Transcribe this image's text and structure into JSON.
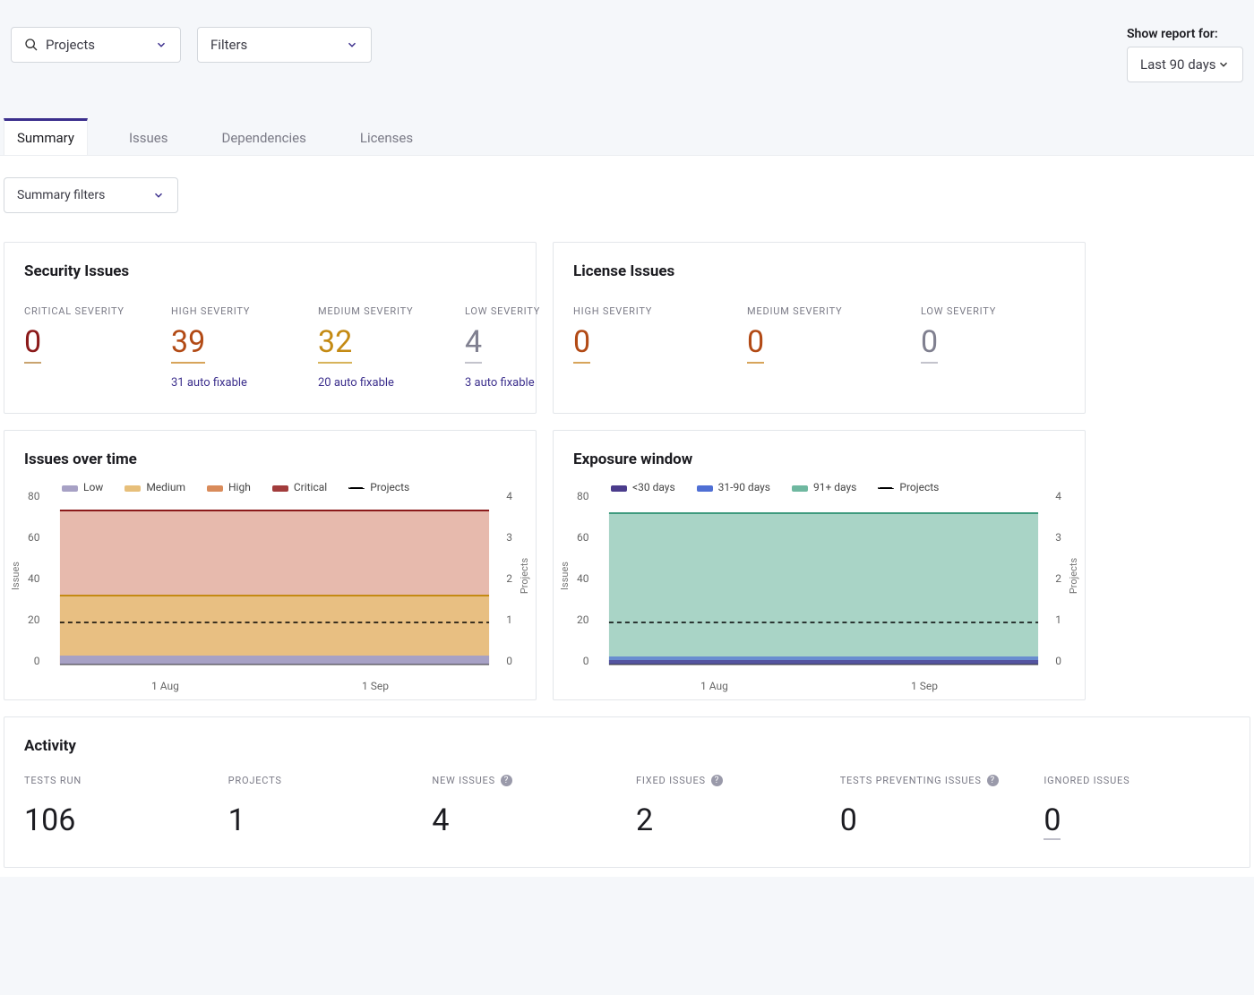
{
  "topbar": {
    "projects_label": "Projects",
    "filters_label": "Filters",
    "report_for_label": "Show report for:",
    "date_range": "Last 90 days"
  },
  "tabs": [
    "Summary",
    "Issues",
    "Dependencies",
    "Licenses"
  ],
  "summary_filters_label": "Summary filters",
  "cards": {
    "security": {
      "title": "Security Issues",
      "stats": [
        {
          "label": "CRITICAL SEVERITY",
          "value": "0",
          "sub": "",
          "cls": "c-crit"
        },
        {
          "label": "HIGH SEVERITY",
          "value": "39",
          "sub": "31 auto fixable",
          "cls": "c-high"
        },
        {
          "label": "MEDIUM SEVERITY",
          "value": "32",
          "sub": "20 auto fixable",
          "cls": "c-med"
        },
        {
          "label": "LOW SEVERITY",
          "value": "4",
          "sub": "3 auto fixable",
          "cls": "c-low"
        }
      ]
    },
    "license": {
      "title": "License Issues",
      "stats": [
        {
          "label": "HIGH SEVERITY",
          "value": "0",
          "cls": "c-high"
        },
        {
          "label": "MEDIUM SEVERITY",
          "value": "0",
          "cls": "c-high"
        },
        {
          "label": "LOW SEVERITY",
          "value": "0",
          "cls": "c-low"
        }
      ]
    }
  },
  "charts": {
    "issues": {
      "title": "Issues over time",
      "legend": [
        "Low",
        "Medium",
        "High",
        "Critical",
        "Projects"
      ],
      "y_left_label": "Issues",
      "y_right_label": "Projects",
      "y_left_ticks": [
        "80",
        "60",
        "40",
        "20",
        "0"
      ],
      "y_right_ticks": [
        "4",
        "3",
        "2",
        "1",
        "0"
      ],
      "x_ticks": [
        "1 Aug",
        "1 Sep"
      ]
    },
    "exposure": {
      "title": "Exposure window",
      "legend": [
        "<30 days",
        "31-90 days",
        "91+ days",
        "Projects"
      ],
      "y_left_label": "Issues",
      "y_right_label": "Projects",
      "y_left_ticks": [
        "80",
        "60",
        "40",
        "20",
        "0"
      ],
      "y_right_ticks": [
        "4",
        "3",
        "2",
        "1",
        "0"
      ],
      "x_ticks": [
        "1 Aug",
        "1 Sep"
      ]
    }
  },
  "activity": {
    "title": "Activity",
    "items": [
      {
        "label": "TESTS RUN",
        "value": "106"
      },
      {
        "label": "PROJECTS",
        "value": "1"
      },
      {
        "label": "NEW ISSES",
        "value": "4",
        "help": true,
        "label_override": "NEW ISSUES"
      },
      {
        "label": "FIXED ISSUES",
        "value": "2",
        "help": true
      },
      {
        "label": "TESTS PREVENTING ISSUES",
        "value": "0",
        "help": true
      },
      {
        "label": "IGNORED ISSUES",
        "value": "0",
        "underlined": true
      }
    ]
  },
  "chart_data": [
    {
      "type": "area",
      "title": "Issues over time",
      "y_left": {
        "label": "Issues",
        "range": [
          0,
          80
        ]
      },
      "y_right": {
        "label": "Projects",
        "range": [
          0,
          4
        ]
      },
      "x_ticks": [
        "1 Aug",
        "1 Sep"
      ],
      "series": [
        {
          "name": "Critical",
          "approx_value": 75,
          "axis": "left",
          "color": "#a23c3c"
        },
        {
          "name": "High",
          "approx_value": 36,
          "axis": "left",
          "color": "#d98b5a"
        },
        {
          "name": "Medium",
          "approx_value": 35,
          "axis": "left",
          "color": "#e7bf7a"
        },
        {
          "name": "Low",
          "approx_value": 4,
          "axis": "left",
          "color": "#a7a1c5"
        },
        {
          "name": "Projects",
          "approx_value": 1,
          "axis": "right",
          "color": "#000",
          "style": "dashed"
        }
      ]
    },
    {
      "type": "area",
      "title": "Exposure window",
      "y_left": {
        "label": "Issues",
        "range": [
          0,
          80
        ]
      },
      "y_right": {
        "label": "Projects",
        "range": [
          0,
          4
        ]
      },
      "x_ticks": [
        "1 Aug",
        "1 Sep"
      ],
      "series": [
        {
          "name": "91+ days",
          "approx_value": 73,
          "axis": "left",
          "color": "#6fb8a0"
        },
        {
          "name": "31-90 days",
          "approx_value": 4,
          "axis": "left",
          "color": "#4f6fd4"
        },
        {
          "name": "<30 days",
          "approx_value": 2,
          "axis": "left",
          "color": "#4b3c8c"
        },
        {
          "name": "Projects",
          "approx_value": 1,
          "axis": "right",
          "color": "#000",
          "style": "dashed"
        }
      ]
    }
  ]
}
